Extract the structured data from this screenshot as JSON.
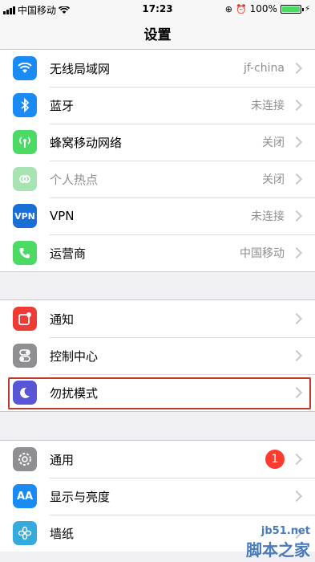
{
  "status_bar": {
    "carrier": "中国移动",
    "time": "17:23",
    "battery": "100%",
    "battery_level": 1.0
  },
  "nav": {
    "title": "设置"
  },
  "groups": [
    {
      "items": [
        {
          "label": "无线局域网",
          "value": "jf-china",
          "icon": "wifi-icon",
          "color": "#1a8bf5"
        },
        {
          "label": "蓝牙",
          "value": "未连接",
          "icon": "bluetooth-icon",
          "color": "#1a8bf5"
        },
        {
          "label": "蜂窝移动网络",
          "value": "关闭",
          "icon": "cellular-icon",
          "color": "#4cd964"
        },
        {
          "label": "个人热点",
          "value": "关闭",
          "icon": "hotspot-icon",
          "color": "#a7e3b3"
        },
        {
          "label": "VPN",
          "value": "未连接",
          "icon": "vpn-icon",
          "color": "#1a6fd6"
        },
        {
          "label": "运营商",
          "value": "中国移动",
          "icon": "phone-icon",
          "color": "#4cd964"
        }
      ]
    },
    {
      "items": [
        {
          "label": "通知",
          "icon": "notifications-icon",
          "color": "#ef3b36"
        },
        {
          "label": "控制中心",
          "icon": "control-center-icon",
          "color": "#8e8e93"
        },
        {
          "label": "勿扰模式",
          "icon": "moon-icon",
          "color": "#5856d6"
        }
      ]
    },
    {
      "items": [
        {
          "label": "通用",
          "badge": "1",
          "icon": "gear-icon",
          "color": "#8e8e93"
        },
        {
          "label": "显示与亮度",
          "icon": "display-icon",
          "color": "#1a8bf5"
        },
        {
          "label": "墙纸",
          "icon": "wallpaper-icon",
          "color": "#35aadc"
        }
      ]
    }
  ],
  "watermark": {
    "site": "jb51.net",
    "name": "脚本之家"
  }
}
